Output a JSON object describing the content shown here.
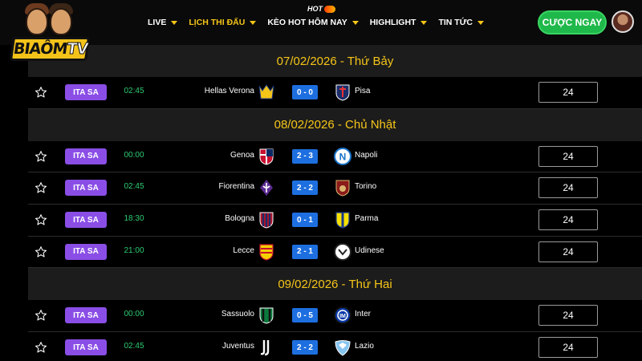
{
  "header": {
    "logo_text": "BIAÔMTV",
    "logo_main": "BIAÔM",
    "logo_tv": "TV",
    "hot_label": "HOT",
    "nav": [
      {
        "label": "LIVE",
        "active": false
      },
      {
        "label": "LỊCH THI ĐẤU",
        "active": true
      },
      {
        "label": "KÈO HOT HÔM NAY",
        "active": false
      },
      {
        "label": "HIGHLIGHT",
        "active": false
      },
      {
        "label": "TIN TỨC",
        "active": false
      }
    ],
    "cta_label": "CƯỢC NGAY"
  },
  "colors": {
    "accent": "#f5c518",
    "league_badge": "#8a4ee6",
    "score_badge": "#1d6fe0",
    "time_text": "#2ecc71",
    "cta": "#1fb84a",
    "date_bar": "#1c1c1c"
  },
  "schedule": {
    "day1": {
      "date": "07/02/2026 - Thứ Bảy",
      "matches": [
        {
          "league": "ITA SA",
          "time": "02:45",
          "home": "Hellas Verona",
          "score": "0 - 0",
          "away": "Pisa",
          "odd": "24"
        }
      ]
    },
    "day2": {
      "date": "08/02/2026 - Chủ Nhật",
      "matches": [
        {
          "league": "ITA SA",
          "time": "00:00",
          "home": "Genoa",
          "score": "2 - 3",
          "away": "Napoli",
          "odd": "24"
        },
        {
          "league": "ITA SA",
          "time": "02:45",
          "home": "Fiorentina",
          "score": "2 - 2",
          "away": "Torino",
          "odd": "24"
        },
        {
          "league": "ITA SA",
          "time": "18:30",
          "home": "Bologna",
          "score": "0 - 1",
          "away": "Parma",
          "odd": "24"
        },
        {
          "league": "ITA SA",
          "time": "21:00",
          "home": "Lecce",
          "score": "2 - 1",
          "away": "Udinese",
          "odd": "24"
        }
      ]
    },
    "day3": {
      "date": "09/02/2026 - Thứ Hai",
      "matches": [
        {
          "league": "ITA SA",
          "time": "00:00",
          "home": "Sassuolo",
          "score": "0 - 5",
          "away": "Inter",
          "odd": "24"
        },
        {
          "league": "ITA SA",
          "time": "02:45",
          "home": "Juventus",
          "score": "2 - 2",
          "away": "Lazio",
          "odd": "24"
        }
      ]
    }
  }
}
